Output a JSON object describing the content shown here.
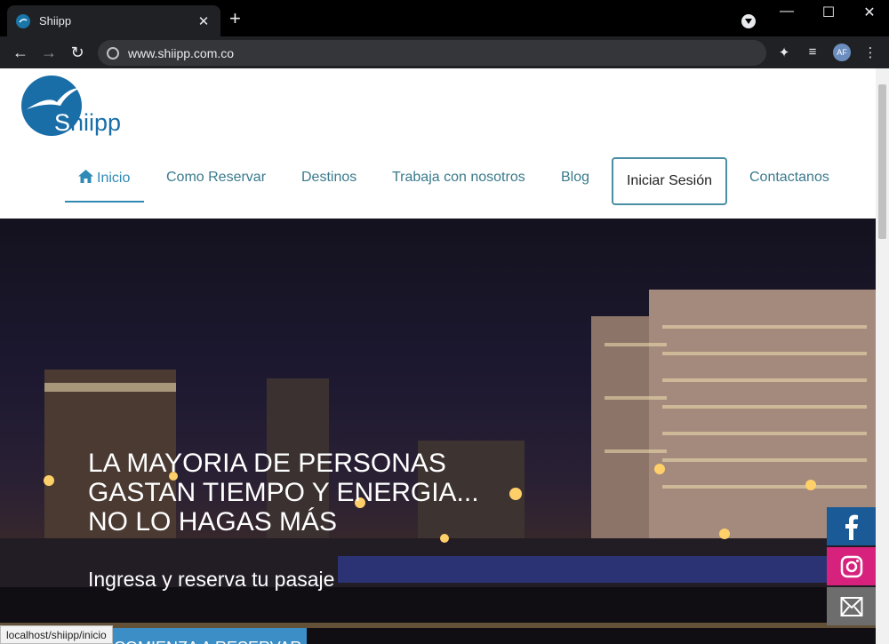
{
  "browser": {
    "tab_title": "Shiipp",
    "url": "www.shiipp.com.co",
    "profile_initials": "AF",
    "status_url": "localhost/shiipp/inicio"
  },
  "site": {
    "logo_first_letter": "S",
    "logo_rest": "hiipp",
    "nav": {
      "inicio": "Inicio",
      "como_reservar": "Como Reservar",
      "destinos": "Destinos",
      "trabaja": "Trabaja con nosotros",
      "blog": "Blog",
      "login": "Iniciar Sesión",
      "contactanos": "Contactanos"
    },
    "hero": {
      "line1": "LA MAYORIA DE PERSONAS",
      "line2": "GASTAN TIEMPO Y ENERGIA...",
      "line3": "NO LO HAGAS MÁS",
      "subtitle": "Ingresa y reserva tu pasaje",
      "cta": "COMIENZA A RESERVAR"
    },
    "social": [
      "facebook-icon",
      "instagram-icon",
      "mail-icon"
    ],
    "colors": {
      "brand": "#1a6ea8",
      "nav_text": "#3a7a8c",
      "facebook": "#1a5a96",
      "instagram": "#d6227c",
      "mail": "#6d6d6d"
    }
  }
}
